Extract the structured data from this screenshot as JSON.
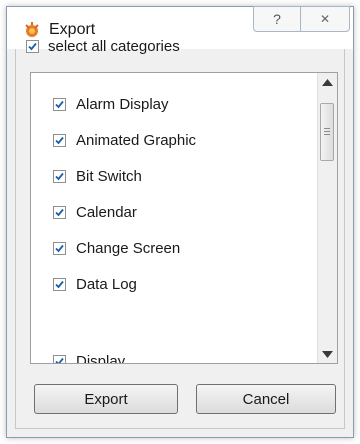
{
  "window": {
    "title": "Export"
  },
  "titlebar": {
    "help_label": "?",
    "close_label": "✕"
  },
  "select_all": {
    "label": "select all categories",
    "checked": true
  },
  "categories": [
    {
      "label": "Alarm Display",
      "checked": true
    },
    {
      "label": "Animated Graphic",
      "checked": true
    },
    {
      "label": "Bit Switch",
      "checked": true
    },
    {
      "label": "Calendar",
      "checked": true
    },
    {
      "label": "Change Screen",
      "checked": true
    },
    {
      "label": "Data Log",
      "checked": true
    },
    {
      "label": "Display",
      "checked": true
    }
  ],
  "buttons": {
    "export_label": "Export",
    "cancel_label": "Cancel"
  },
  "colors": {
    "check": "#1a5fa8",
    "border": "#8a9bb3"
  }
}
